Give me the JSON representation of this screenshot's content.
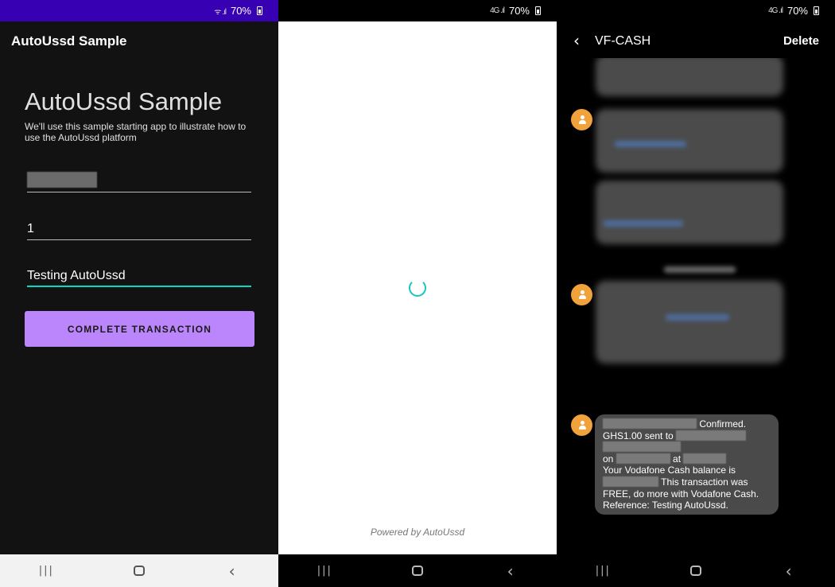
{
  "status": {
    "battery_percent": "70%"
  },
  "app_screen": {
    "title": "AutoUssd Sample",
    "heading": "AutoUssd Sample",
    "subtitle": "We'll use this sample starting app to illustrate how to use the AutoUssd platform",
    "amount_value": "1",
    "reference_value": "Testing AutoUssd",
    "complete_button": "COMPLETE TRANSACTION"
  },
  "loading_screen": {
    "powered_by": "Powered by AutoUssd"
  },
  "messages_screen": {
    "sender": "VF-CASH",
    "delete_label": "Delete",
    "last_message": {
      "confirmed": "Confirmed.",
      "sent_to": "GHS1.00 sent to",
      "on": "on",
      "at": "at",
      "balance_is": "Your Vodafone Cash balance is",
      "free_note_1": "This transaction was",
      "free_note_2": "FREE, do more with Vodafone Cash.",
      "reference": "Reference: Testing AutoUssd."
    }
  },
  "colors": {
    "status_bar_purple": "#3700b3",
    "accent_purple": "#bb86fc",
    "accent_teal": "#03dac5",
    "spinner_teal": "#17c5c0",
    "avatar_orange": "#f2a23a"
  }
}
